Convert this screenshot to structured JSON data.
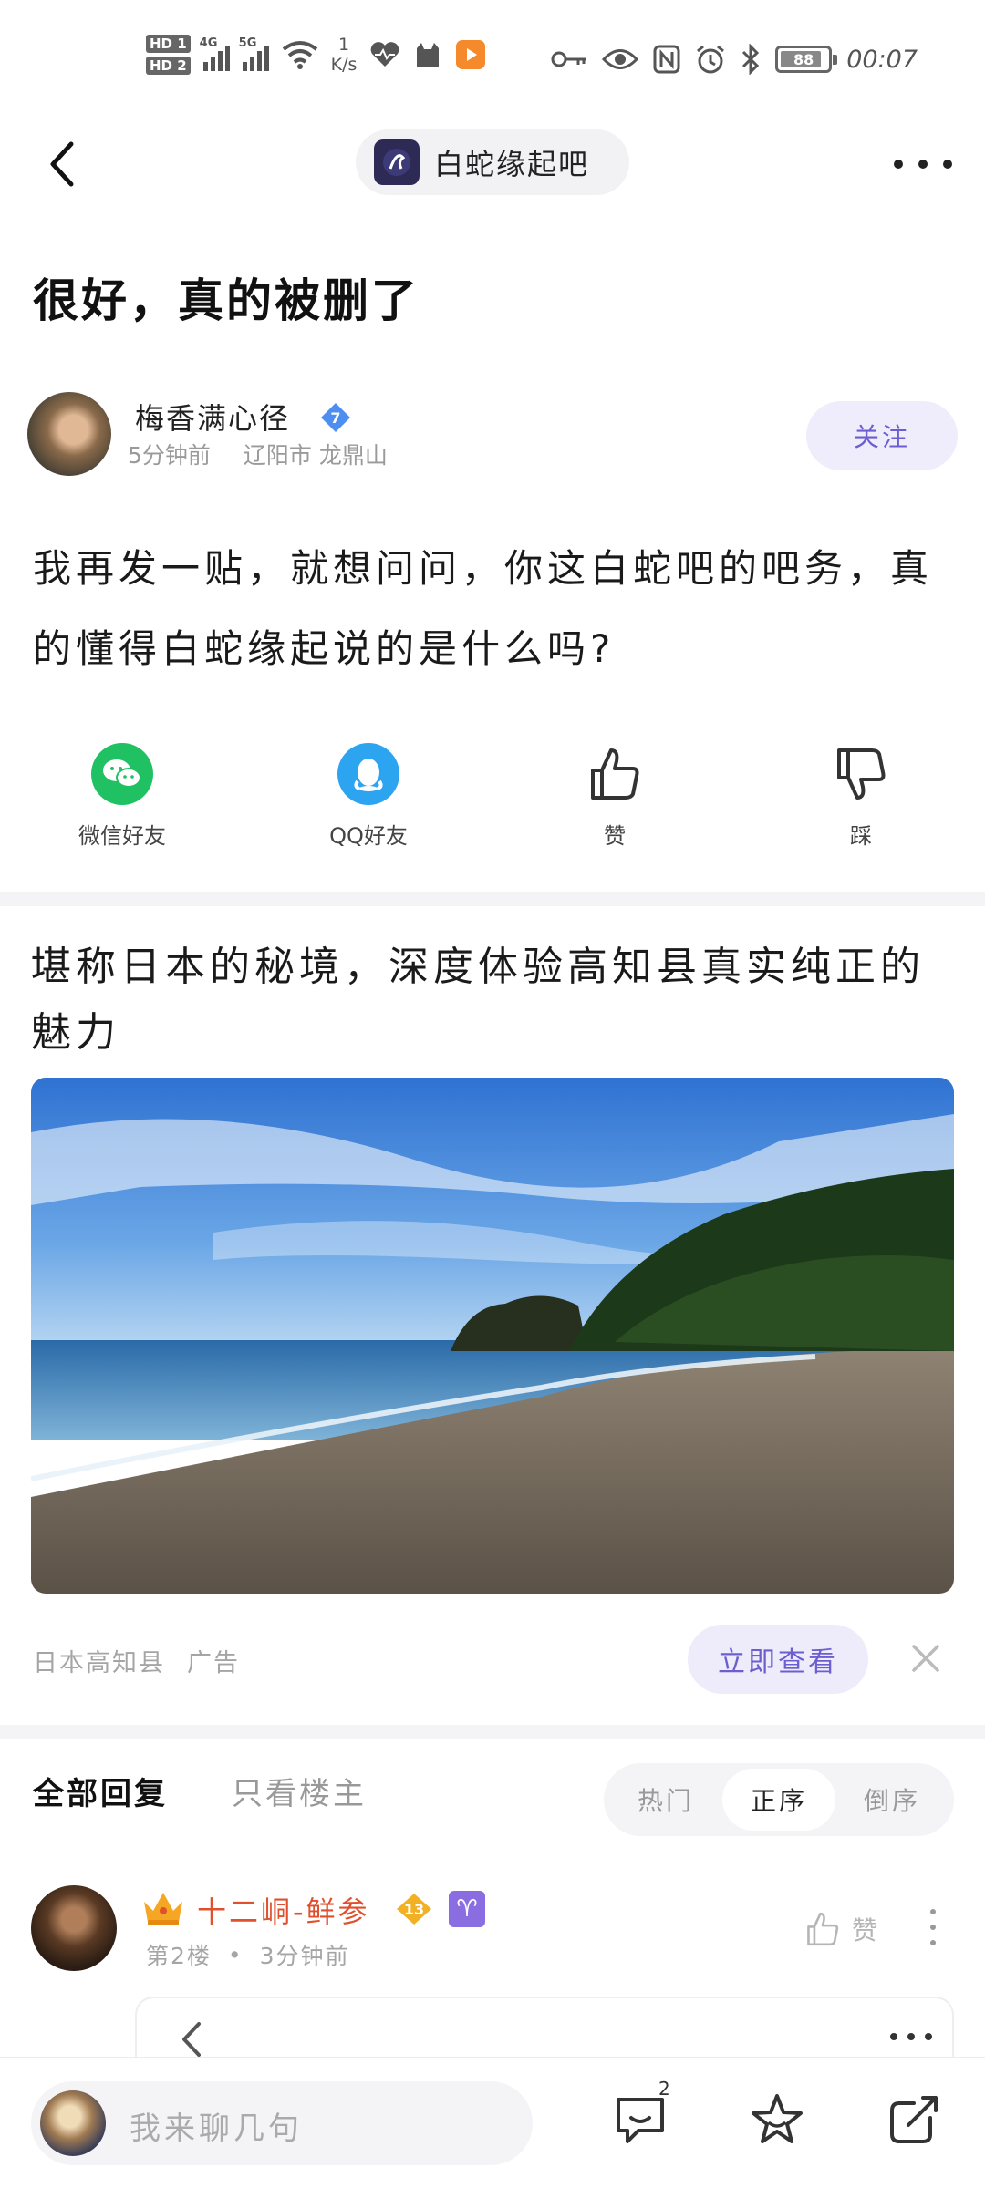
{
  "status_bar": {
    "hd1": "HD 1",
    "hd2": "HD 2",
    "net1": "4G",
    "net2": "5G",
    "speed_value": "1",
    "speed_unit": "K/s",
    "battery": "88",
    "time": "00:07"
  },
  "nav": {
    "forum_name": "白蛇缘起吧"
  },
  "post": {
    "title": "很好，真的被删了",
    "author": {
      "name": "梅香满心径",
      "level": "7",
      "time": "5分钟前",
      "location": "辽阳市 龙鼎山"
    },
    "follow_label": "关注",
    "body": "我再发一贴，就想问问，你这白蛇吧的吧务，真的懂得白蛇缘起说的是什么吗?"
  },
  "share": {
    "wechat": "微信好友",
    "qq": "QQ好友",
    "like": "赞",
    "dislike": "踩"
  },
  "ad": {
    "title": "堪称日本的秘境，深度体验高知县真实纯正的魅力",
    "source": "日本高知县",
    "tag": "广告",
    "cta": "立即查看"
  },
  "replies": {
    "tab_all": "全部回复",
    "tab_owner": "只看楼主",
    "sort_hot": "热门",
    "sort_asc": "正序",
    "sort_desc": "倒序",
    "items": [
      {
        "name": "十二峒-鲜参",
        "level": "13",
        "zodiac": "♈",
        "floor": "第2楼",
        "dot": "•",
        "time": "3分钟前",
        "like": "赞"
      }
    ]
  },
  "bottom": {
    "placeholder": "我来聊几句",
    "comment_count": "2"
  },
  "colors": {
    "accent": "#6b5fd0",
    "accent_bg": "#efedfb",
    "wechat": "#1fc163",
    "qq": "#2da4f0",
    "name_red": "#e0502c",
    "badge_blue": "#4d8ef0",
    "badge_gold": "#f2b124"
  }
}
